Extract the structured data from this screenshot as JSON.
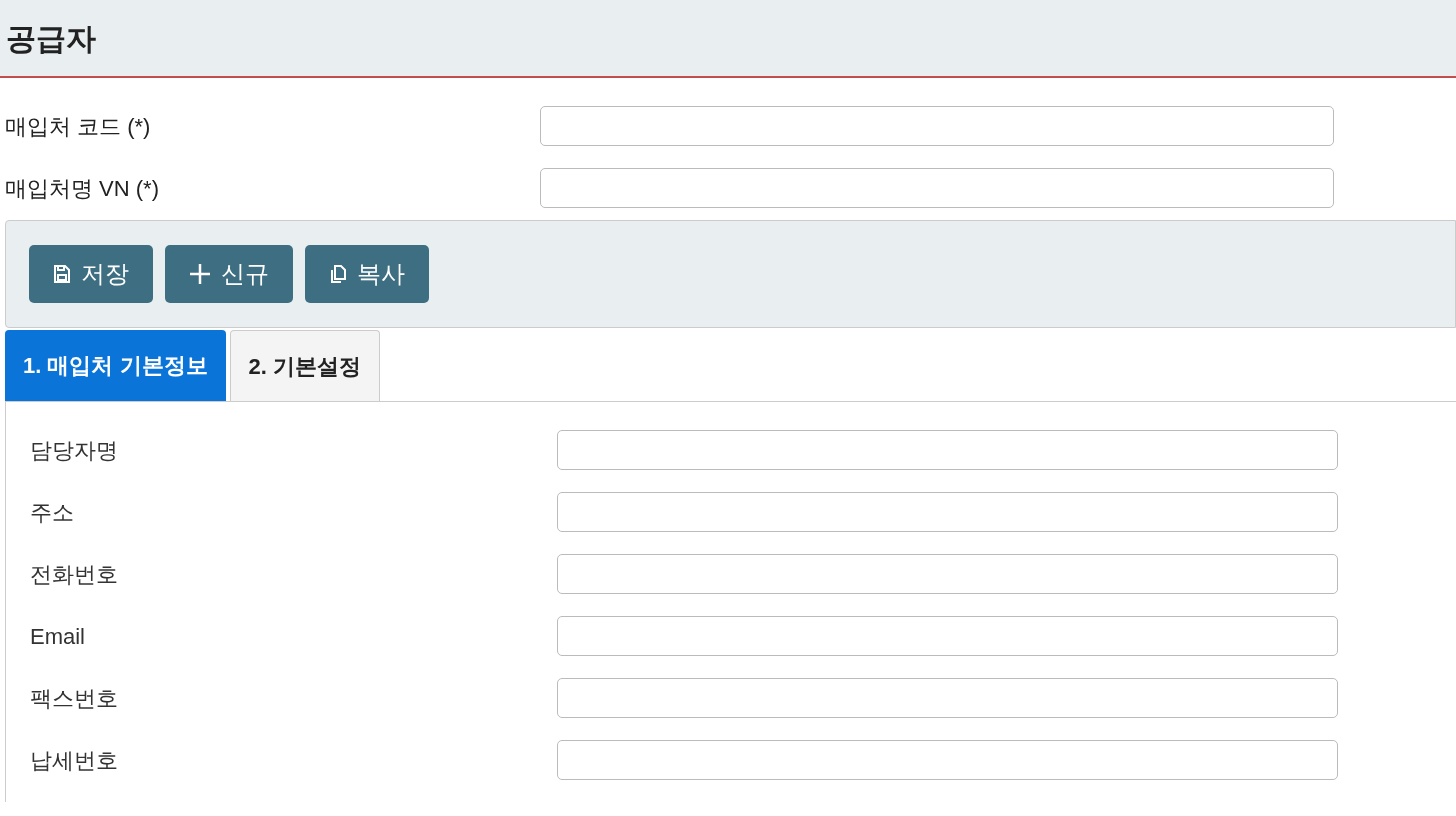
{
  "page": {
    "title": "공급자"
  },
  "header_fields": [
    {
      "label": "매입처 코드 (*)"
    },
    {
      "label": "매입처명 VN (*)"
    }
  ],
  "toolbar": [
    {
      "kind": "save",
      "label": "저장"
    },
    {
      "kind": "new",
      "label": "신규"
    },
    {
      "kind": "copy",
      "label": "복사"
    }
  ],
  "tabs": [
    {
      "label": "1. 매입처 기본정보",
      "selected": true
    },
    {
      "label": "2. 기본설정",
      "selected": false
    }
  ],
  "form_fields": [
    {
      "label": "담당자명"
    },
    {
      "label": "주소"
    },
    {
      "label": "전화번호"
    },
    {
      "label": "Email"
    },
    {
      "label": "팩스번호"
    },
    {
      "label": "납세번호"
    }
  ]
}
